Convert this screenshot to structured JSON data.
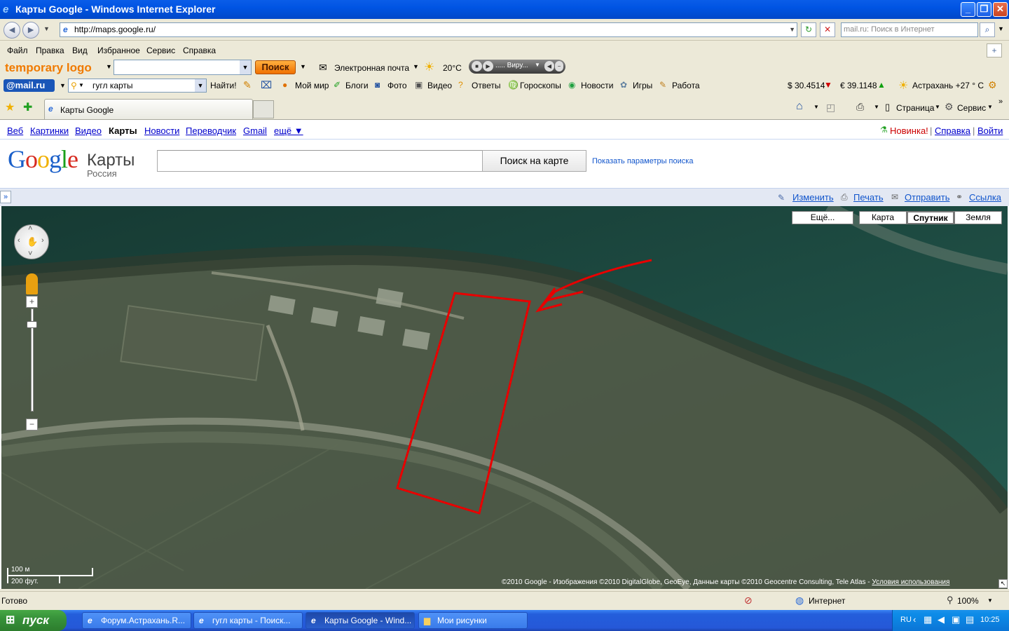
{
  "window": {
    "title": "Карты Google - Windows Internet Explorer",
    "minimize": "_",
    "restore": "❐",
    "close": "✕"
  },
  "address": {
    "url": "http://maps.google.ru/",
    "search_placeholder": "mail.ru: Поиск в Интернет"
  },
  "menu": [
    "Файл",
    "Правка",
    "Вид",
    "Избранное",
    "Сервис",
    "Справка"
  ],
  "toolbar1": {
    "logo": "temporary logo",
    "search_btn": "Поиск",
    "email": "Электронная почта",
    "weather": "20°C",
    "player_text": "..... Виру..."
  },
  "toolbar2": {
    "mailru": "@mail.ru",
    "search_value": "гугл карты",
    "find": "Найти!",
    "links": [
      "Мой мир",
      "Блоги",
      "Фото",
      "Видео",
      "Ответы",
      "Гороскопы",
      "Новости",
      "Игры",
      "Работа"
    ],
    "usd": "$ 30.4514",
    "eur": "€ 39.1148",
    "city_weather": "Астрахань +27 ° С"
  },
  "tabs": {
    "active": "Карты Google",
    "page_menu": "Страница",
    "tools_menu": "Сервис"
  },
  "google": {
    "nav": [
      "Веб",
      "Картинки",
      "Видео",
      "Карты",
      "Новости",
      "Переводчик",
      "Gmail",
      "ещё ▼"
    ],
    "right": {
      "new": "Новинка!",
      "help": "Справка",
      "login": "Войти"
    },
    "logo": "Google",
    "product": "Карты",
    "country": "Россия",
    "search_button": "Поиск на карте",
    "options_link": "Показать параметры поиска"
  },
  "mapbar": {
    "edit": "Изменить",
    "print": "Печать",
    "send": "Отправить",
    "link": "Ссылка"
  },
  "map": {
    "types": [
      "Ещё...",
      "Карта",
      "Спутник",
      "Земля"
    ],
    "selected_type": "Спутник",
    "scale_m": "100 м",
    "scale_ft": "200 фут.",
    "copyright": "©2010 Google - Изображения ©2010 DigitalGlobe, GeoEye, Данные карты ©2010 Geocentre Consulting, Tele Atlas - ",
    "terms": "Условия использования"
  },
  "status": {
    "text": "Готово",
    "zone": "Интернет",
    "zoom": "100%"
  },
  "taskbar": {
    "start": "пуск",
    "tasks": [
      "Форум.Астрахань.R...",
      "гугл карты - Поиск...",
      "Карты Google - Wind...",
      "Мои рисунки"
    ],
    "lang": "RU",
    "time": "10:25"
  }
}
